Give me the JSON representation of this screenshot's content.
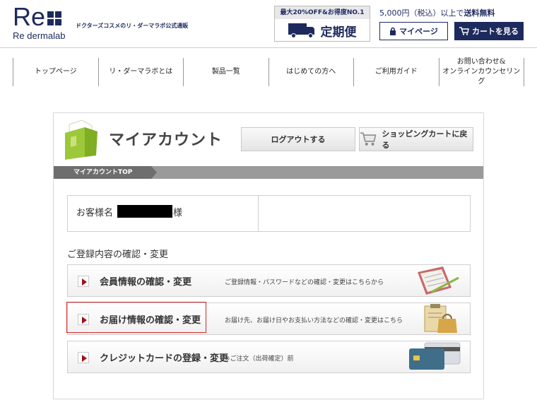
{
  "header": {
    "logo_text": "Re",
    "logo_sub": "Re dermalab",
    "tagline": "ドクターズコスメのリ・ダーマラボ公式通販",
    "teiki_promo": "最大20%OFF&お得度NO.1",
    "teiki_label": "定期便",
    "shipping_prefix": "5,000円（税込）以上で",
    "shipping_bold": "送料無料",
    "mypage_label": "マイページ",
    "cart_label": "カートを見る"
  },
  "nav": {
    "items": [
      {
        "label": "トップページ"
      },
      {
        "label": "リ・ダーマラボとは"
      },
      {
        "label": "製品一覧"
      },
      {
        "label": "はじめての方へ"
      },
      {
        "label": "ご利用ガイド"
      },
      {
        "label_line1": "お問い合わせ&",
        "label_line2": "オンラインカウンセリング"
      }
    ]
  },
  "account": {
    "title": "マイアカウント",
    "logout_label": "ログアウトする",
    "back_cart_label": "ショッピングカートに戻る",
    "breadcrumb": "マイアカウントTOP",
    "customer_label": "お客様名",
    "customer_suffix": "様",
    "section_heading": "ご登録内容の確認・変更",
    "rows": [
      {
        "label": "会員情報の確認・変更",
        "desc": "ご登録情報・パスワードなどの確認・変更はこちらから"
      },
      {
        "label": "お届け情報の確認・変更",
        "desc": "お届け先、お届け日やお支払い方法などの確認・変更はこちら"
      },
      {
        "label": "クレジットカードの登録・変更",
        "desc": "※ご注文（出荷確定）前"
      }
    ]
  },
  "colors": {
    "brand_navy": "#1d2a5e",
    "arrow_red": "#a00e14",
    "highlight_red": "#d02a2a",
    "folder_green": "#9cc83a"
  }
}
